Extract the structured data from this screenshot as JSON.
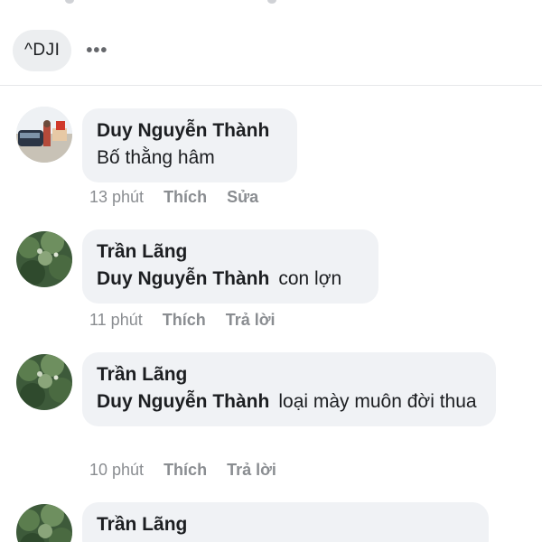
{
  "header": {
    "tag_label": "^DJI",
    "more_label": "•••"
  },
  "comments": [
    {
      "author": "Duy Nguyễn Thành",
      "mention": "",
      "text": "Bố thằng hâm",
      "time": "13 phút",
      "like": "Thích",
      "action2": "Sửa"
    },
    {
      "author": "Trần Lãng",
      "mention": "Duy Nguyễn Thành",
      "text": "con lợn",
      "time": "11 phút",
      "like": "Thích",
      "action2": "Trả lời"
    },
    {
      "author": "Trần Lãng",
      "mention": "Duy Nguyễn Thành",
      "text": "loại mày muôn đời thua",
      "time": "10 phút",
      "like": "Thích",
      "action2": "Trả lời"
    },
    {
      "author": "Trần Lãng"
    }
  ]
}
